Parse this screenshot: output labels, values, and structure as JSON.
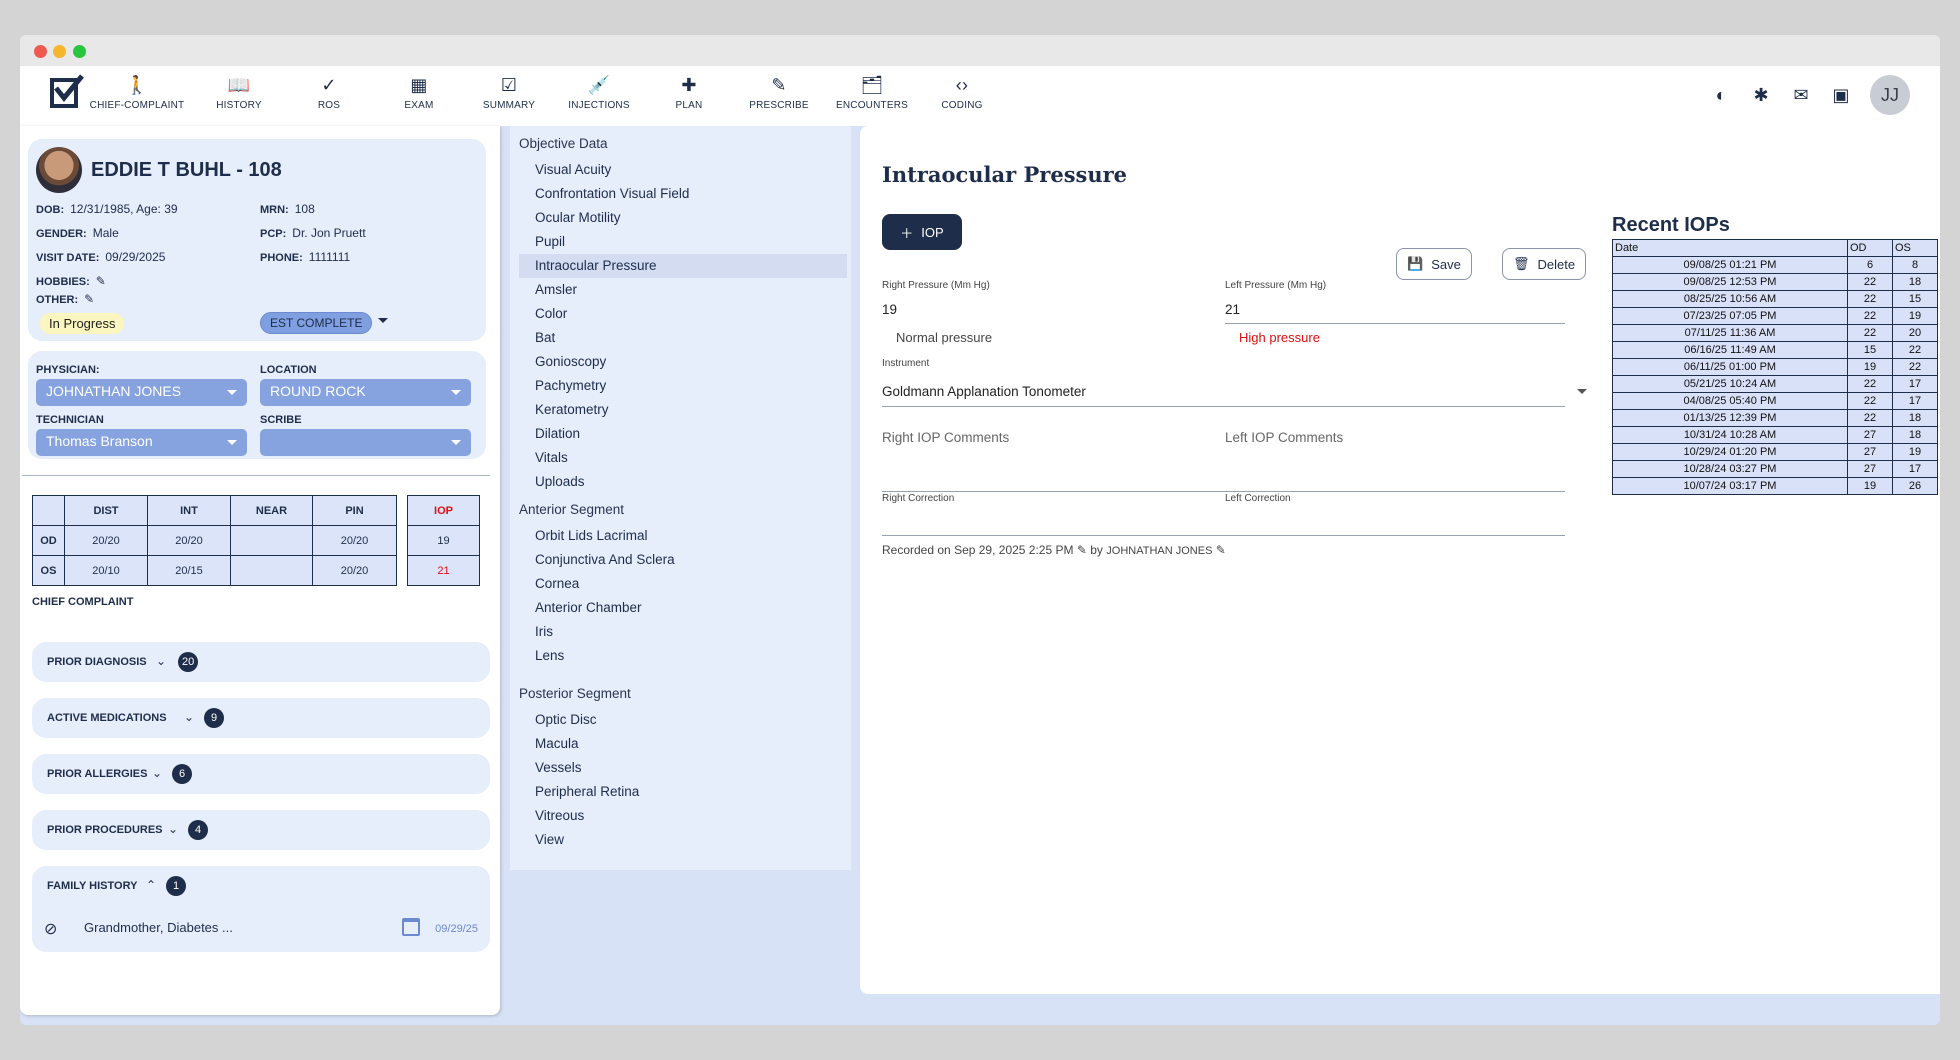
{
  "nav": {
    "items": [
      {
        "label": "CHIEF-COMPLAINT",
        "icon": "person-icon"
      },
      {
        "label": "HISTORY",
        "icon": "book-icon"
      },
      {
        "label": "ROS",
        "icon": "check-icon"
      },
      {
        "label": "EXAM",
        "icon": "bar-chart-icon"
      },
      {
        "label": "SUMMARY",
        "icon": "clipboard-check-icon"
      },
      {
        "label": "INJECTIONS",
        "icon": "syringe-icon"
      },
      {
        "label": "PLAN",
        "icon": "medical-plus-icon"
      },
      {
        "label": "PRESCRIBE",
        "icon": "pencil-icon"
      },
      {
        "label": "ENCOUNTERS",
        "icon": "folder-person-icon"
      },
      {
        "label": "CODING",
        "icon": "code-icon"
      }
    ],
    "user_initials": "JJ"
  },
  "patient": {
    "name": "EDDIE T BUHL - 108",
    "dob_label": "DOB:",
    "dob": "12/31/1985, Age: 39",
    "mrn_label": "MRN:",
    "mrn": "108",
    "gender_label": "GENDER:",
    "gender": "Male",
    "pcp_label": "PCP:",
    "pcp": "Dr. Jon Pruett",
    "visit_label": "VISIT DATE:",
    "visit_date": "09/29/2025",
    "phone_label": "PHONE:",
    "phone": "1111111",
    "hobbies_label": "HOBBIES:",
    "other_label": "OTHER:",
    "status": "In Progress",
    "est_status": "EST COMPLETE"
  },
  "staff": {
    "physician_label": "PHYSICIAN:",
    "physician": "JOHNATHAN JONES",
    "location_label": "LOCATION",
    "location": "ROUND ROCK",
    "technician_label": "TECHNICIAN",
    "technician": "Thomas Branson",
    "scribe_label": "SCRIBE",
    "scribe": ""
  },
  "va": {
    "headers": [
      "DIST",
      "INT",
      "NEAR",
      "PIN"
    ],
    "iop_header": "IOP",
    "rows": [
      {
        "eye": "OD",
        "dist": "20/20",
        "int": "20/20",
        "near": "",
        "pin": "20/20",
        "iop": "19"
      },
      {
        "eye": "OS",
        "dist": "20/10",
        "int": "20/15",
        "near": "",
        "pin": "20/20",
        "iop": "21"
      }
    ]
  },
  "chief_complaint_label": "CHIEF COMPLAINT",
  "sections": [
    {
      "label": "PRIOR DIAGNOSIS",
      "count": "20"
    },
    {
      "label": "ACTIVE MEDICATIONS",
      "count": "9"
    },
    {
      "label": "PRIOR ALLERGIES",
      "count": "6"
    },
    {
      "label": "PRIOR PROCEDURES",
      "count": "4"
    },
    {
      "label": "FAMILY HISTORY",
      "count": "1"
    }
  ],
  "family_history": {
    "item": "Grandmother, Diabetes ...",
    "date": "09/29/25"
  },
  "exam_menu": {
    "objective_label": "Objective Data",
    "objective": [
      "Visual Acuity",
      "Confrontation Visual Field",
      "Ocular Motility",
      "Pupil",
      "Intraocular Pressure",
      "Amsler",
      "Color",
      "Bat",
      "Gonioscopy",
      "Pachymetry",
      "Keratometry",
      "Dilation",
      "Vitals",
      "Uploads"
    ],
    "anterior_label": "Anterior Segment",
    "anterior": [
      "Orbit Lids Lacrimal",
      "Conjunctiva And Sclera",
      "Cornea",
      "Anterior Chamber",
      "Iris",
      "Lens"
    ],
    "posterior_label": "Posterior Segment",
    "posterior": [
      "Optic Disc",
      "Macula",
      "Vessels",
      "Peripheral Retina",
      "Vitreous",
      "View"
    ]
  },
  "iop_form": {
    "title": "Intraocular Pressure",
    "add_label": "IOP",
    "save_label": "Save",
    "delete_label": "Delete",
    "right_label": "Right Pressure (Mm Hg)",
    "right_value": "19",
    "left_label": "Left Pressure (Mm Hg)",
    "left_value": "21",
    "right_helper": "Normal pressure",
    "left_helper": "High pressure",
    "instrument_label": "Instrument",
    "instrument": "Goldmann Applanation Tonometer",
    "right_comments_placeholder": "Right IOP Comments",
    "left_comments_placeholder": "Left IOP Comments",
    "right_correction_label": "Right Correction",
    "left_correction_label": "Left Correction",
    "recorded_prefix": "Recorded on",
    "recorded_date": "Sep 29, 2025 2:25 PM",
    "by_label": "by",
    "recorded_by": "JOHNATHAN JONES"
  },
  "recent_iops": {
    "title": "Recent IOPs",
    "headers": [
      "Date",
      "OD",
      "OS"
    ],
    "rows": [
      [
        "09/08/25 01:21 PM",
        "6",
        "8"
      ],
      [
        "09/08/25 12:53 PM",
        "22",
        "18"
      ],
      [
        "08/25/25 10:56 AM",
        "22",
        "15"
      ],
      [
        "07/23/25 07:05 PM",
        "22",
        "19"
      ],
      [
        "07/11/25 11:36 AM",
        "22",
        "20"
      ],
      [
        "06/16/25 11:49 AM",
        "15",
        "22"
      ],
      [
        "06/11/25 01:00 PM",
        "19",
        "22"
      ],
      [
        "05/21/25 10:24 AM",
        "22",
        "17"
      ],
      [
        "04/08/25 05:40 PM",
        "22",
        "17"
      ],
      [
        "01/13/25 12:39 PM",
        "22",
        "18"
      ],
      [
        "10/31/24 10:28 AM",
        "27",
        "18"
      ],
      [
        "10/29/24 01:20 PM",
        "27",
        "19"
      ],
      [
        "10/28/24 03:27 PM",
        "27",
        "17"
      ],
      [
        "10/07/24 03:17 PM",
        "19",
        "26"
      ]
    ]
  },
  "colors": {
    "primary": "#1e2d4a",
    "accent": "#86a3e0",
    "panel": "#e6edfb",
    "alert": "#e01010"
  }
}
